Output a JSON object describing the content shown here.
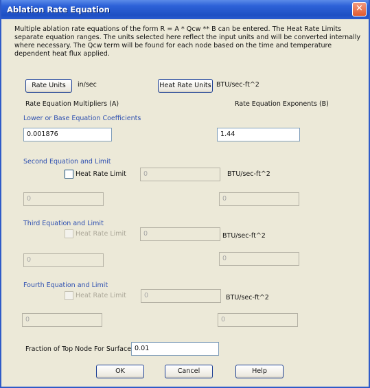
{
  "dialog": {
    "title": "Ablation Rate Equation",
    "close_glyph": "✕",
    "description": "Multiple ablation rate equations of the form  R = A * Qcw ** B can be entered. The Heat Rate Limits separate equation ranges. The units selected here reflect the input units and will be converted internally where necessary. The Qcw term will be found for each node based on the time and temperature dependent heat flux applied.",
    "rate_units_label": "Rate Units",
    "rate_units_value": "in/sec",
    "heat_rate_units_label": "Heat Rate Units",
    "heat_rate_units_value": "BTU/sec-ft^2",
    "multipliers_header": "Rate Equation Multipliers (A)",
    "exponents_header": "Rate Equation Exponents (B)",
    "sections": [
      {
        "title": "Lower or Base Equation Coefficients",
        "multiplier": "0.001876",
        "exponent": "1.44"
      },
      {
        "title": "Second Equation and Limit",
        "limit_label": "Heat Rate Limit",
        "limit_value": "0",
        "limit_units": "BTU/sec-ft^2",
        "multiplier": "0",
        "exponent": "0",
        "checked": false
      },
      {
        "title": "Third Equation and Limit",
        "limit_label": "Heat Rate Limit",
        "limit_value": "0",
        "limit_units": "BTU/sec-ft^2",
        "multiplier": "0",
        "exponent": "0",
        "checked": false
      },
      {
        "title": "Fourth Equation and Limit",
        "limit_label": "Heat Rate Limit",
        "limit_value": "0",
        "limit_units": "BTU/sec-ft^2",
        "multiplier": "0",
        "exponent": "0",
        "checked": false
      }
    ],
    "fraction_label": "Fraction of Top Node For Surface:",
    "fraction_value": "0.01",
    "ok_label": "OK",
    "cancel_label": "Cancel",
    "help_label": "Help"
  }
}
